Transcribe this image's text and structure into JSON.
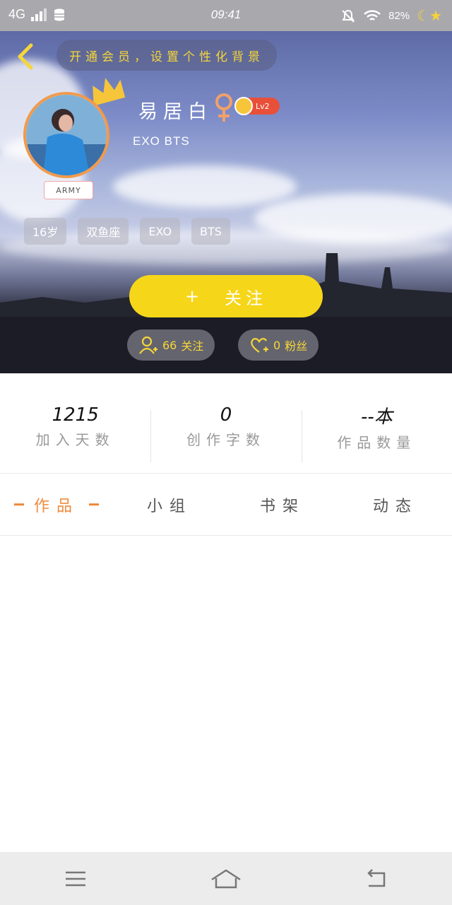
{
  "status_bar": {
    "network": "4G",
    "time": "09:41",
    "battery": "82%",
    "icons": [
      "signal-icon",
      "database-icon",
      "mute-bell-icon",
      "wifi-icon",
      "moon-battery-icon"
    ]
  },
  "header": {
    "back_icon": "chevron-left-icon",
    "background_prompt": "开通会员，设置个性化背景",
    "username": "易居白",
    "gender_icon": "female-icon",
    "level": "Lv2",
    "bio": "EXO BTS",
    "avatar_badge": "ARMY",
    "tags": [
      "16岁",
      "双鱼座",
      "EXO",
      "BTS"
    ],
    "follow_button": {
      "icon": "+",
      "label": "关注"
    },
    "following": {
      "count": "66",
      "label": "关注",
      "icon": "add-user-icon"
    },
    "fans": {
      "count": "0",
      "label": "粉丝",
      "icon": "heart-plus-icon"
    }
  },
  "stats": [
    {
      "value": "1215",
      "label": "加入天数"
    },
    {
      "value": "0",
      "label": "创作字数"
    },
    {
      "value": "--本",
      "label": "作品数量"
    }
  ],
  "tabs": [
    {
      "label": "作品",
      "active": true
    },
    {
      "label": "小组",
      "active": false
    },
    {
      "label": "书架",
      "active": false
    },
    {
      "label": "动态",
      "active": false
    }
  ],
  "nav": {
    "menu_icon": "menu-icon",
    "home_icon": "home-icon",
    "back_icon": "back-arrow-icon"
  },
  "colors": {
    "accent_yellow": "#f6d619",
    "accent_orange": "#ef8a3c",
    "level_red": "#e8503a"
  }
}
